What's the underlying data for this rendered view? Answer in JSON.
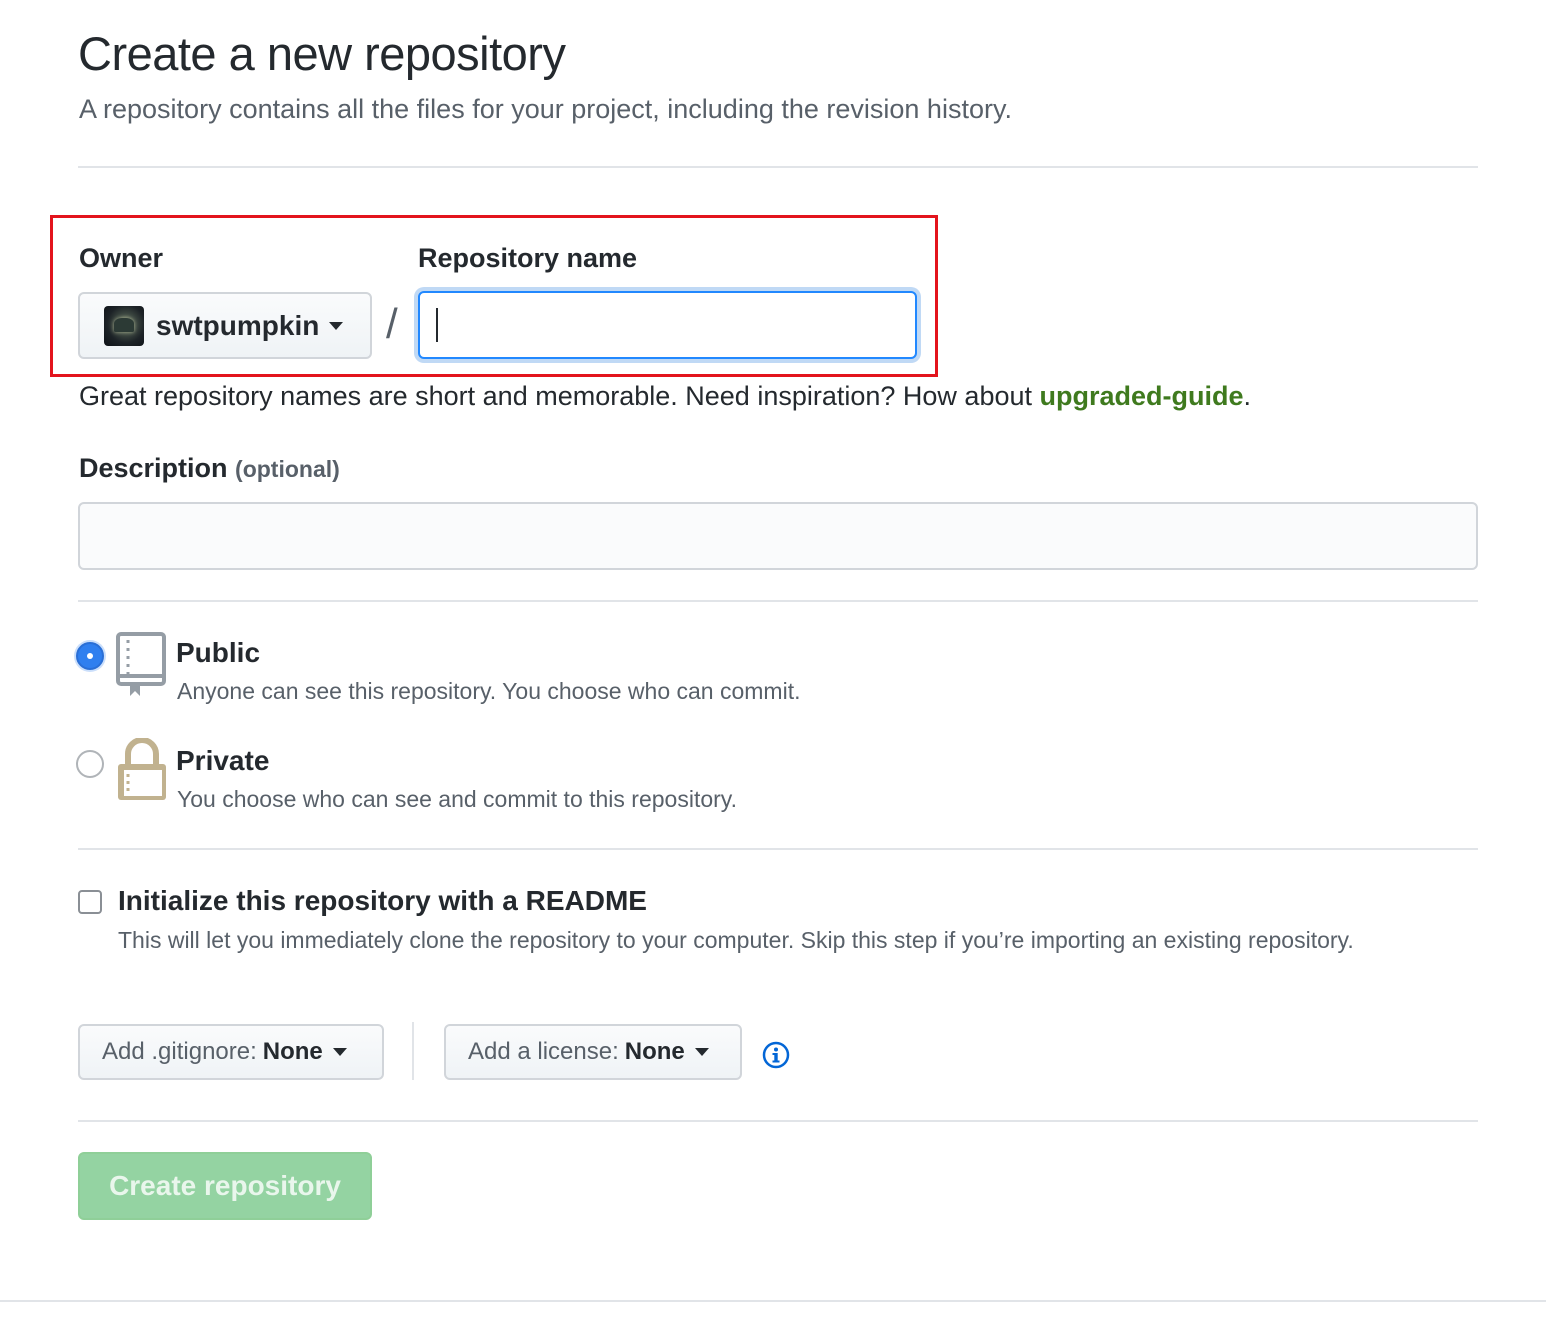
{
  "header": {
    "title": "Create a new repository",
    "subtitle": "A repository contains all the files for your project, including the revision history."
  },
  "owner": {
    "label": "Owner",
    "selected": "swtpumpkin"
  },
  "separator": "/",
  "repo_name": {
    "label": "Repository name",
    "value": "",
    "hint_prefix": "Great repository names are short and memorable. Need inspiration? How about ",
    "suggestion": "upgraded-guide",
    "hint_suffix": "."
  },
  "description": {
    "label": "Description",
    "optional": "(optional)",
    "value": ""
  },
  "visibility": {
    "public": {
      "title": "Public",
      "desc": "Anyone can see this repository. You choose who can commit.",
      "checked": true
    },
    "private": {
      "title": "Private",
      "desc": "You choose who can see and commit to this repository.",
      "checked": false
    }
  },
  "readme": {
    "title": "Initialize this repository with a README",
    "desc": "This will let you immediately clone the repository to your computer. Skip this step if you’re importing an existing repository.",
    "checked": false
  },
  "gitignore": {
    "prefix": "Add .gitignore:",
    "value": "None"
  },
  "license": {
    "prefix": "Add a license:",
    "value": "None"
  },
  "submit": {
    "label": "Create repository"
  },
  "colors": {
    "accent_blue": "#2188ff",
    "suggestion_green": "#3f7a1e",
    "create_button_disabled": "#94d3a2",
    "highlight_red": "#e3141d"
  }
}
